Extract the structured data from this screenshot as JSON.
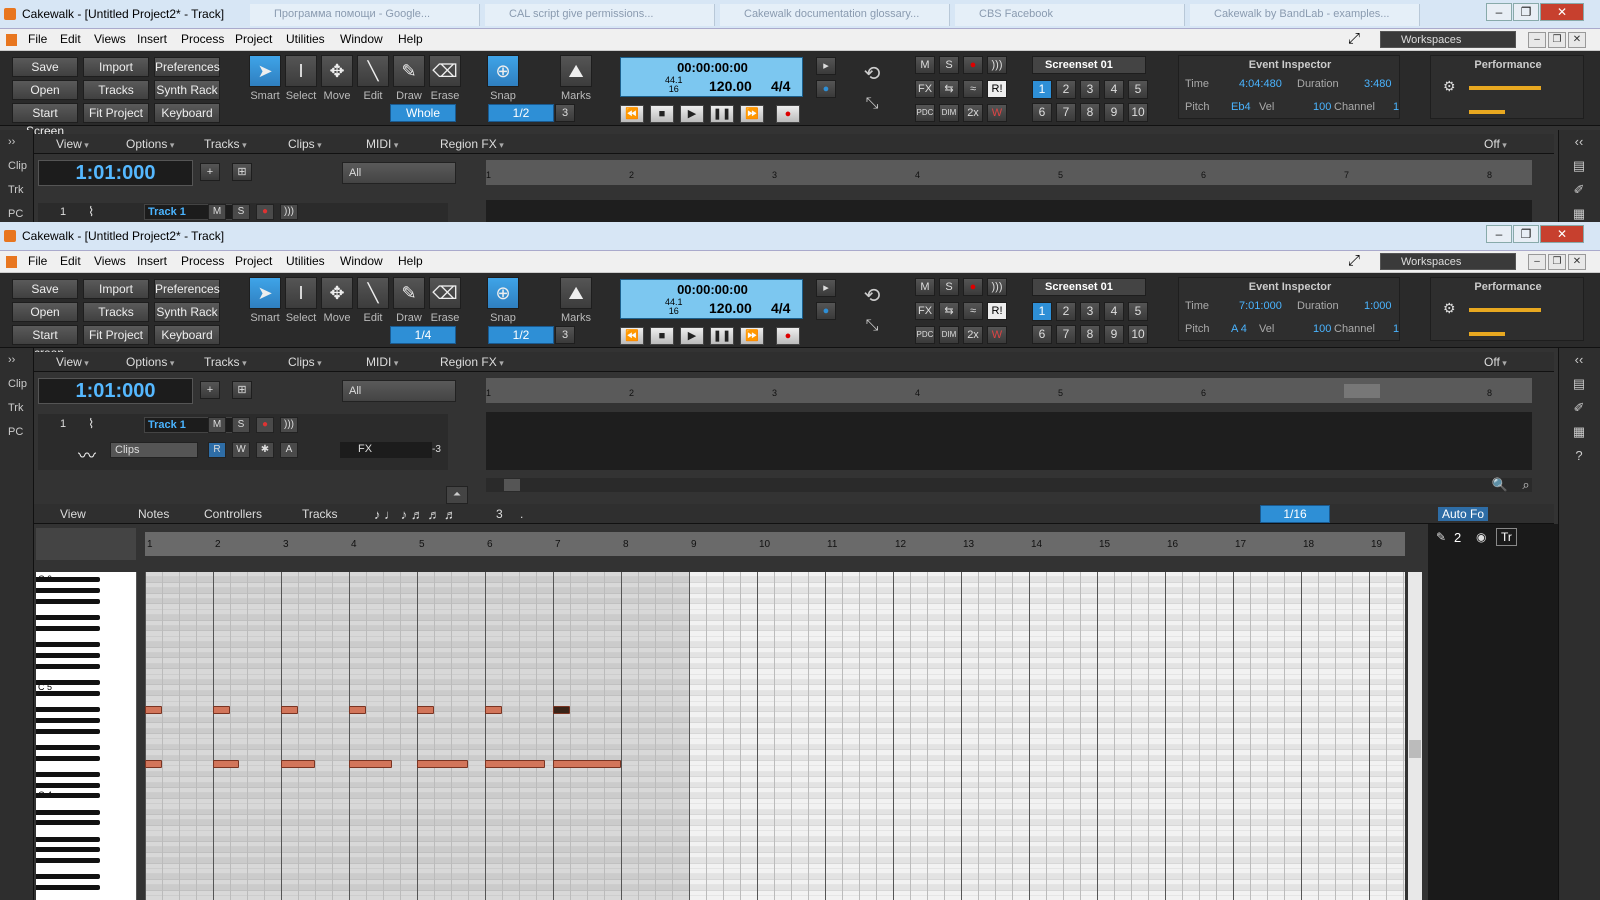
{
  "windows": [
    {
      "title": "Cakewalk - [Untitled Project2* - Track]",
      "ghost_tabs": [
        "Программа помощи - Google...",
        "CAL script give permissions...",
        "Cakewalk documentation glossary...",
        "CBS Facebook",
        "Cakewalk by BandLab - examples..."
      ],
      "menu": [
        "File",
        "Edit",
        "Views",
        "Insert",
        "Process",
        "Project",
        "Utilities",
        "Window",
        "Help"
      ],
      "workspaces": "Workspaces",
      "buttons": [
        "Save",
        "Import",
        "Preferences",
        "Open",
        "Tracks",
        "Synth Rack",
        "Start Screen",
        "Fit Project",
        "Keyboard"
      ],
      "tools": [
        "Smart",
        "Select",
        "Move",
        "Edit",
        "Draw",
        "Erase"
      ],
      "snap_label": "Snap",
      "marks_label": "Marks",
      "edit_duration": "Whole",
      "snap_value": "1/2",
      "snap_triplet": "3",
      "lcd": {
        "time": "00:00:00:00",
        "rate": "44.1",
        "bits": "16",
        "tempo": "120.00",
        "meter": "4/4"
      },
      "screenset": "Screenset 01",
      "screenset_nums": [
        "1",
        "2",
        "3",
        "4",
        "5",
        "6",
        "7",
        "8",
        "9",
        "10"
      ],
      "inspector": {
        "title": "Event Inspector",
        "time_label": "Time",
        "time": "4:04:480",
        "dur_label": "Duration",
        "duration": "3:480",
        "pitch_label": "Pitch",
        "pitch": "Eb4",
        "vel_label": "Vel",
        "vel": "100",
        "ch_label": "Channel",
        "channel": "1"
      },
      "performance": "Performance",
      "dock": [
        "Clip",
        "Trk",
        "PC"
      ],
      "trk_menus": [
        "View",
        "Options",
        "Tracks",
        "Clips",
        "MIDI",
        "Region FX"
      ],
      "now_time": "1:01:000",
      "filter": "All",
      "ruler": [
        "1",
        "2",
        "3",
        "4",
        "5",
        "6",
        "7",
        "8"
      ],
      "loop_off": "Off",
      "track": {
        "num": "1",
        "name": "Track 1"
      }
    },
    {
      "title": "Cakewalk - [Untitled Project2* - Track]",
      "menu": [
        "File",
        "Edit",
        "Views",
        "Insert",
        "Process",
        "Project",
        "Utilities",
        "Window",
        "Help"
      ],
      "workspaces": "Workspaces",
      "buttons": [
        "Save",
        "Import",
        "Preferences",
        "Open",
        "Tracks",
        "Synth Rack",
        "Start Screen",
        "Fit Project",
        "Keyboard"
      ],
      "tools": [
        "Smart",
        "Select",
        "Move",
        "Edit",
        "Draw",
        "Erase"
      ],
      "snap_label": "Snap",
      "marks_label": "Marks",
      "edit_duration": "1/4",
      "snap_value": "1/2",
      "snap_triplet": "3",
      "lcd": {
        "time": "00:00:00:00",
        "rate": "44.1",
        "bits": "16",
        "tempo": "120.00",
        "meter": "4/4"
      },
      "screenset": "Screenset 01",
      "screenset_nums": [
        "1",
        "2",
        "3",
        "4",
        "5",
        "6",
        "7",
        "8",
        "9",
        "10"
      ],
      "inspector": {
        "title": "Event Inspector",
        "time_label": "Time",
        "time": "7:01:000",
        "dur_label": "Duration",
        "duration": "1:000",
        "pitch_label": "Pitch",
        "pitch": "A 4",
        "vel_label": "Vel",
        "vel": "100",
        "ch_label": "Channel",
        "channel": "1"
      },
      "performance": "Performance",
      "dock": [
        "Clip",
        "Trk",
        "PC"
      ],
      "trk_menus": [
        "View",
        "Options",
        "Tracks",
        "Clips",
        "MIDI",
        "Region FX"
      ],
      "now_time": "1:01:000",
      "filter": "All",
      "ruler": [
        "1",
        "2",
        "3",
        "4",
        "5",
        "6",
        "7",
        "8"
      ],
      "loop_off": "Off",
      "track": {
        "num": "1",
        "name": "Track 1",
        "clips": "Clips",
        "fx": "FX",
        "rwa": [
          "R",
          "W",
          "✱",
          "A"
        ],
        "meter_val": "-3"
      }
    }
  ],
  "piano_roll": {
    "menus": [
      "View",
      "Notes",
      "Controllers",
      "Tracks"
    ],
    "triplet": "3",
    "dot": ".",
    "snap": "1/16",
    "auto_focus": "Auto Fo",
    "ruler": [
      "1",
      "2",
      "3",
      "4",
      "5",
      "6",
      "7",
      "8",
      "9",
      "10",
      "11",
      "12",
      "13",
      "14",
      "15",
      "16",
      "17",
      "18",
      "19"
    ],
    "key_labels": [
      "C 6",
      "C 5",
      "C 4"
    ],
    "track_count": "2",
    "tr": "Tr",
    "notes_top": [
      {
        "bar": 1.0,
        "len": 0.25
      },
      {
        "bar": 2.0,
        "len": 0.25
      },
      {
        "bar": 3.0,
        "len": 0.25
      },
      {
        "bar": 4.0,
        "len": 0.25
      },
      {
        "bar": 5.0,
        "len": 0.25
      },
      {
        "bar": 6.0,
        "len": 0.25
      },
      {
        "bar": 7.0,
        "len": 0.25,
        "selected": true
      }
    ],
    "notes_bottom": [
      {
        "bar": 1.0,
        "len": 0.25
      },
      {
        "bar": 2.0,
        "len": 0.375
      },
      {
        "bar": 3.0,
        "len": 0.5
      },
      {
        "bar": 4.0,
        "len": 0.625
      },
      {
        "bar": 5.0,
        "len": 0.75
      },
      {
        "bar": 6.0,
        "len": 0.875
      },
      {
        "bar": 7.0,
        "len": 1.0
      }
    ]
  }
}
